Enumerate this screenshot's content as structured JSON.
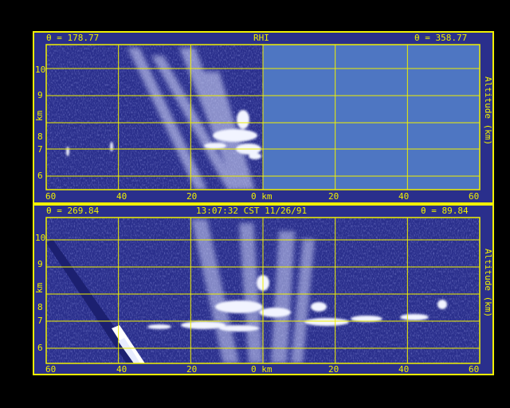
{
  "colors": {
    "frame": "#000000",
    "axes": "#f0f000",
    "sky": "#2a2f8c",
    "empty_panel": "#4e76c2",
    "echo": "#e8ecff"
  },
  "top_panel": {
    "left_angle": "θ = 178.77",
    "title": "RHI",
    "right_angle": "θ = 358.77",
    "y_ticks": [
      "10",
      "9",
      "8",
      "7",
      "6"
    ],
    "y_unit_left": "km",
    "y_label_right": "Altitude (km)",
    "x_ticks": [
      "60",
      "40",
      "20",
      "0 km",
      "20",
      "40",
      "60"
    ],
    "right_half": "no data"
  },
  "bottom_panel": {
    "left_angle": "θ = 269.84",
    "timestamp": "13:07:32 CST 11/26/91",
    "right_angle": "θ = 89.84",
    "y_ticks": [
      "10",
      "9",
      "8",
      "7",
      "6"
    ],
    "y_unit_left": "km",
    "y_label_right": "Altitude (km)",
    "x_ticks": [
      "60",
      "40",
      "20",
      "0 km",
      "20",
      "40",
      "60"
    ]
  }
}
